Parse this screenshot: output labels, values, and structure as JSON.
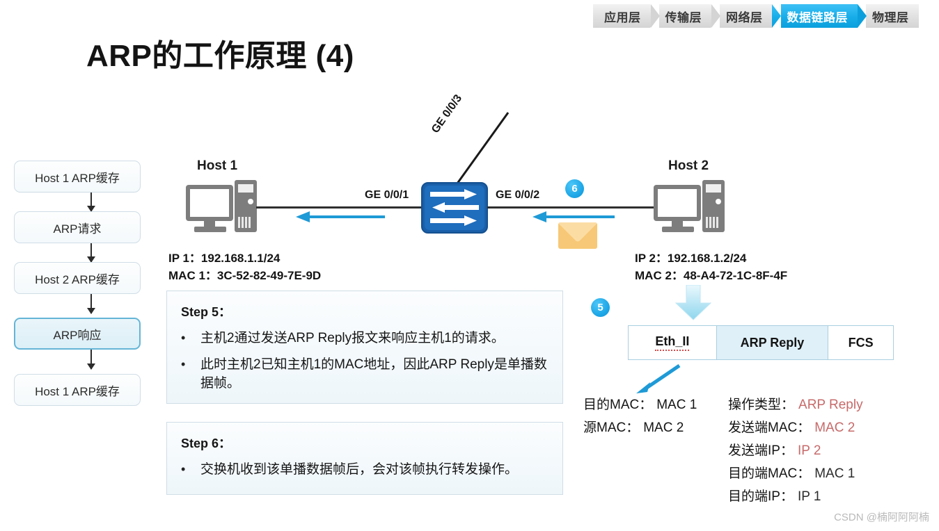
{
  "breadcrumb": {
    "items": [
      {
        "label": "应用层",
        "active": false
      },
      {
        "label": "传输层",
        "active": false
      },
      {
        "label": "网络层",
        "active": false
      },
      {
        "label": "数据链路层",
        "active": true
      },
      {
        "label": "物理层",
        "active": false
      }
    ],
    "active_color": "#17ade9",
    "inactive_color": "#dcdcdc"
  },
  "title": "ARP的工作原理 (4)",
  "flowchart": {
    "steps": [
      {
        "label": "Host 1 ARP缓存",
        "highlighted": false
      },
      {
        "label": "ARP请求",
        "highlighted": false
      },
      {
        "label": "Host 2 ARP缓存",
        "highlighted": false
      },
      {
        "label": "ARP响应",
        "highlighted": true
      },
      {
        "label": "Host 1 ARP缓存",
        "highlighted": false
      }
    ],
    "highlight_border_color": "#64b5d6",
    "highlight_fill_color": "#e3f1f8"
  },
  "network": {
    "host1": {
      "name": "Host 1",
      "ip": "IP 1：192.168.1.1/24",
      "mac": "MAC 1：3C-52-82-49-7E-9D"
    },
    "host2": {
      "name": "Host 2",
      "ip": "IP 2：192.168.1.2/24",
      "mac": "MAC 2：48-A4-72-1C-8F-4F"
    },
    "ports": {
      "left": "GE 0/0/1",
      "right": "GE 0/0/2",
      "up": "GE 0/0/3"
    },
    "switch_icon": "network-switch-icon",
    "badge_6": "6",
    "badge_5": "5",
    "flow_arrow_color": "#1e9ad6",
    "envelope_color": "#f7c877"
  },
  "steps": [
    {
      "title": "Step 5：",
      "items": [
        "主机2通过发送ARP Reply报文来响应主机1的请求。",
        "此时主机2已知主机1的MAC地址，因此ARP Reply是单播数据帧。"
      ]
    },
    {
      "title": "Step 6：",
      "items": [
        "交换机收到该单播数据帧后，会对该帧执行转发操作。"
      ]
    }
  ],
  "frame": {
    "cells": [
      {
        "label": "Eth_II",
        "tint": false,
        "misspelled": true
      },
      {
        "label": "ARP Reply",
        "tint": true,
        "misspelled": false
      },
      {
        "label": "FCS",
        "tint": false,
        "misspelled": false
      }
    ]
  },
  "frame_fields": {
    "left": [
      {
        "label": "目的MAC：",
        "value": "MAC 1",
        "color": "#141414"
      },
      {
        "label": "源MAC：",
        "value": "MAC 2",
        "color": "#141414"
      }
    ],
    "right": [
      {
        "label": "操作类型：",
        "value": "ARP Reply",
        "color": "#c76a6a"
      },
      {
        "label": "发送端MAC：",
        "value": "MAC 2",
        "color": "#c76a6a"
      },
      {
        "label": "发送端IP：",
        "value": "IP 2",
        "color": "#c76a6a"
      },
      {
        "label": "目的端MAC：",
        "value": "MAC 1",
        "color": "#2b2b2b"
      },
      {
        "label": "目的端IP：",
        "value": "IP 1",
        "color": "#2b2b2b"
      }
    ]
  },
  "watermark": "CSDN @楠阿阿阿楠"
}
